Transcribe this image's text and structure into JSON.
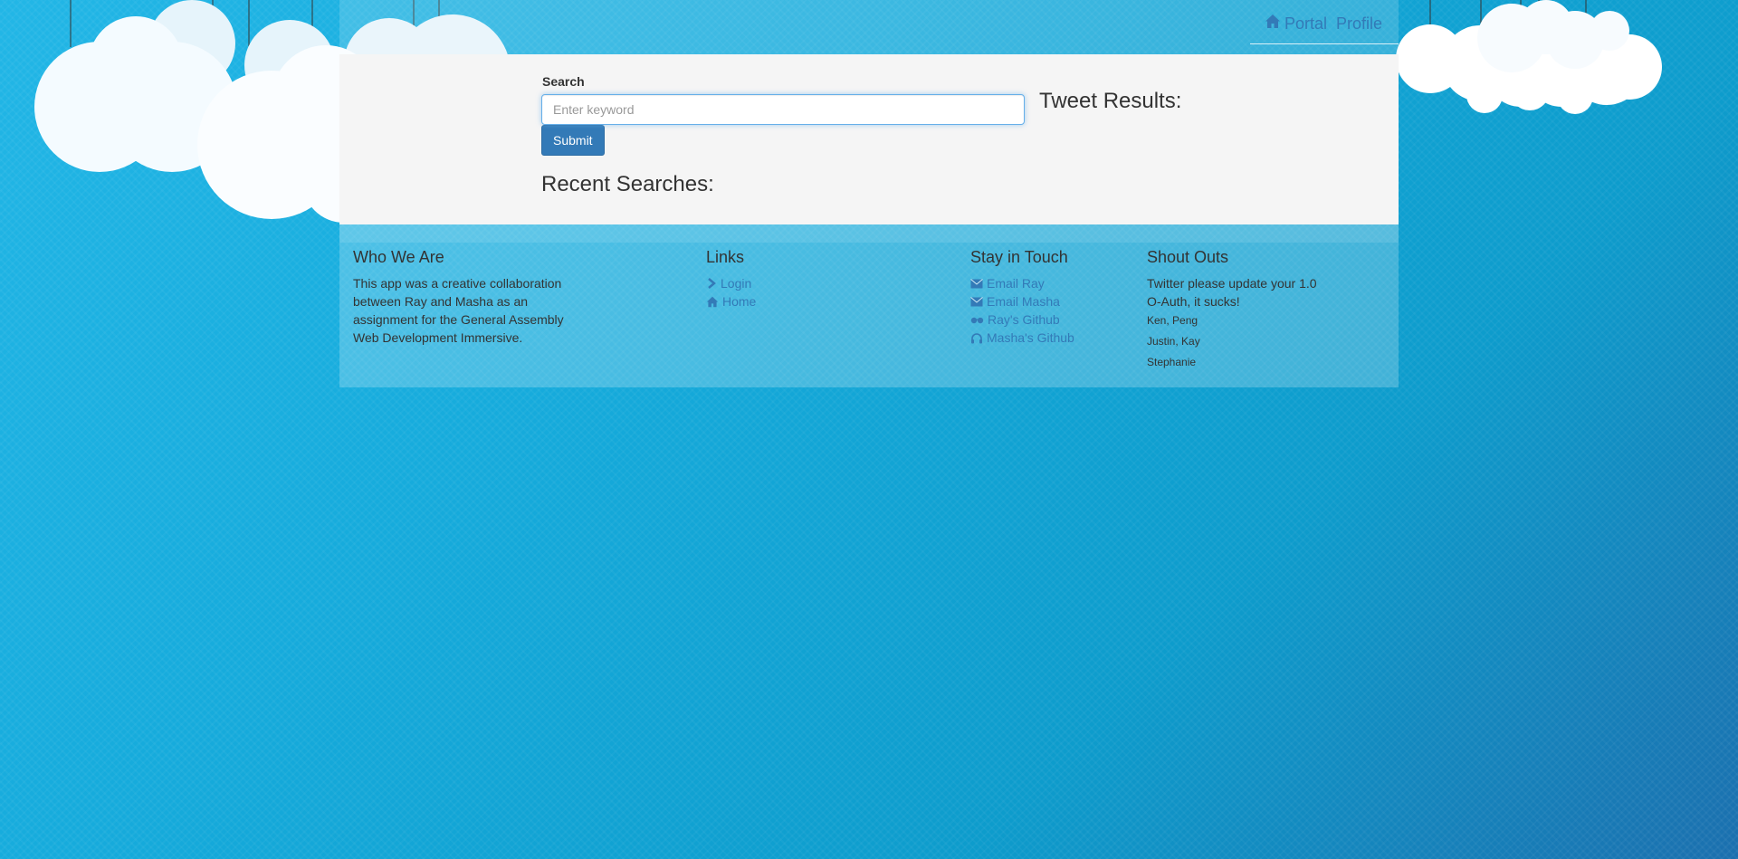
{
  "nav": {
    "portal_label": "Portal",
    "profile_label": "Profile"
  },
  "search": {
    "label": "Search",
    "placeholder": "Enter keyword",
    "value": "",
    "submit_label": "Submit"
  },
  "recent": {
    "title": "Recent Searches:"
  },
  "tweets": {
    "title": "Tweet Results:"
  },
  "footer": {
    "who": {
      "heading": "Who We Are",
      "text": "This app was a creative collaboration between Ray and Masha as an assignment for the General Assembly Web Development Immersive."
    },
    "links": {
      "heading": "Links",
      "items": [
        {
          "label": "Login",
          "icon": "chevron-right-icon"
        },
        {
          "label": "Home",
          "icon": "home-icon"
        }
      ]
    },
    "touch": {
      "heading": "Stay in Touch",
      "items": [
        {
          "label": "Email Ray",
          "icon": "envelope-icon"
        },
        {
          "label": "Email Masha",
          "icon": "envelope-icon"
        },
        {
          "label": "Ray's Github",
          "icon": "sunglasses-icon"
        },
        {
          "label": "Masha's Github",
          "icon": "headphones-icon"
        }
      ]
    },
    "shout": {
      "heading": "Shout Outs",
      "text": "Twitter please update your 1.0 O-Auth, it sucks!",
      "names": [
        "Ken, Peng",
        "Justin, Kay",
        "Stephanie"
      ]
    }
  },
  "colors": {
    "link": "#337ab7",
    "button": "#337ab7",
    "background_top": "#22b6e6",
    "background_bottom": "#1b6fae"
  }
}
